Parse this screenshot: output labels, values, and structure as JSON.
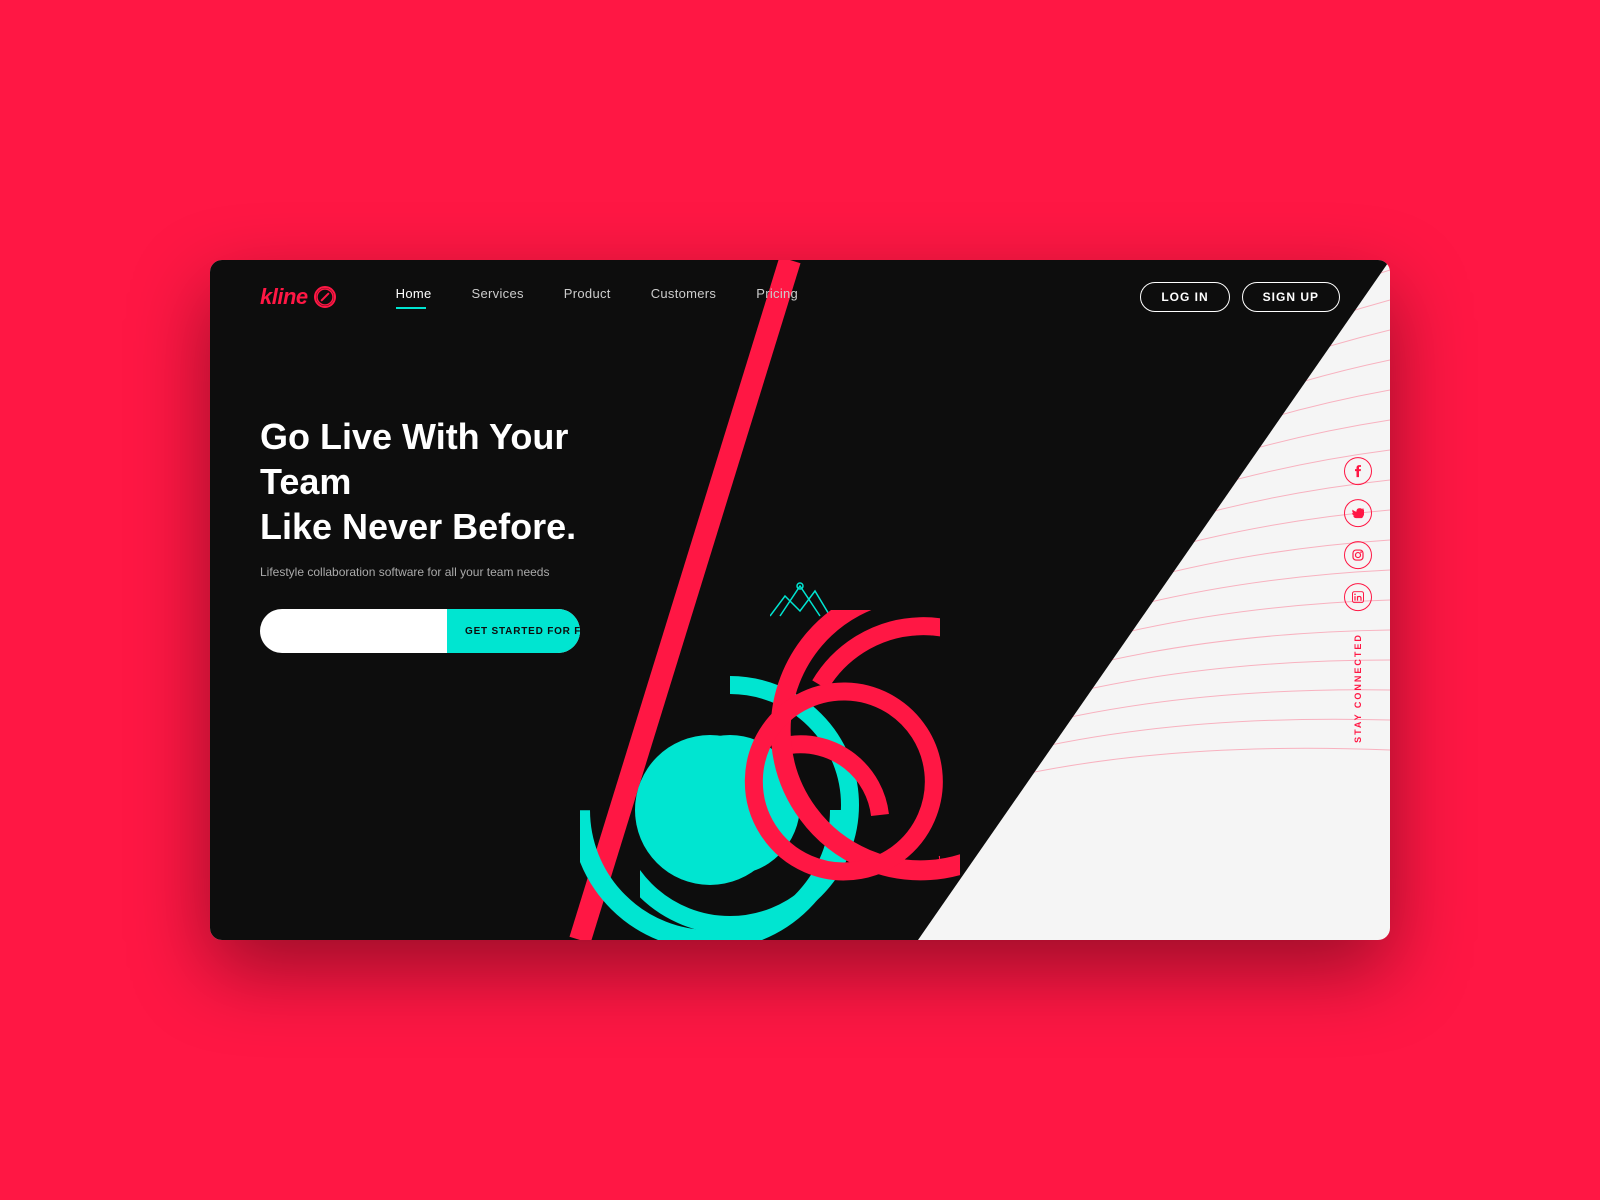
{
  "brand": {
    "name": "kline",
    "tagline": "Lifestyle collaboration software for all your team needs"
  },
  "nav": {
    "links": [
      {
        "label": "Home",
        "active": true
      },
      {
        "label": "Services",
        "active": false
      },
      {
        "label": "Product",
        "active": false
      },
      {
        "label": "Customers",
        "active": false
      },
      {
        "label": "Pricing",
        "active": false
      }
    ],
    "login_label": "LOG IN",
    "signup_label": "SIGN UP"
  },
  "hero": {
    "title_line1": "Go Live With Your Team",
    "title_line2": "Like Never Before.",
    "subtitle": "Lifestyle collaboration software for all your team needs",
    "cta_placeholder": "",
    "cta_button": "GET STARTED FOR FREE"
  },
  "social": {
    "label": "STAY CONNECTED",
    "icons": [
      {
        "name": "facebook",
        "symbol": "f"
      },
      {
        "name": "twitter",
        "symbol": "t"
      },
      {
        "name": "instagram",
        "symbol": "in"
      },
      {
        "name": "linkedin",
        "symbol": "li"
      }
    ]
  },
  "colors": {
    "accent_cyan": "#00E5D1",
    "accent_red": "#FF1744",
    "dark_bg": "#0d0d0d",
    "light_bg": "#f5f5f5"
  }
}
